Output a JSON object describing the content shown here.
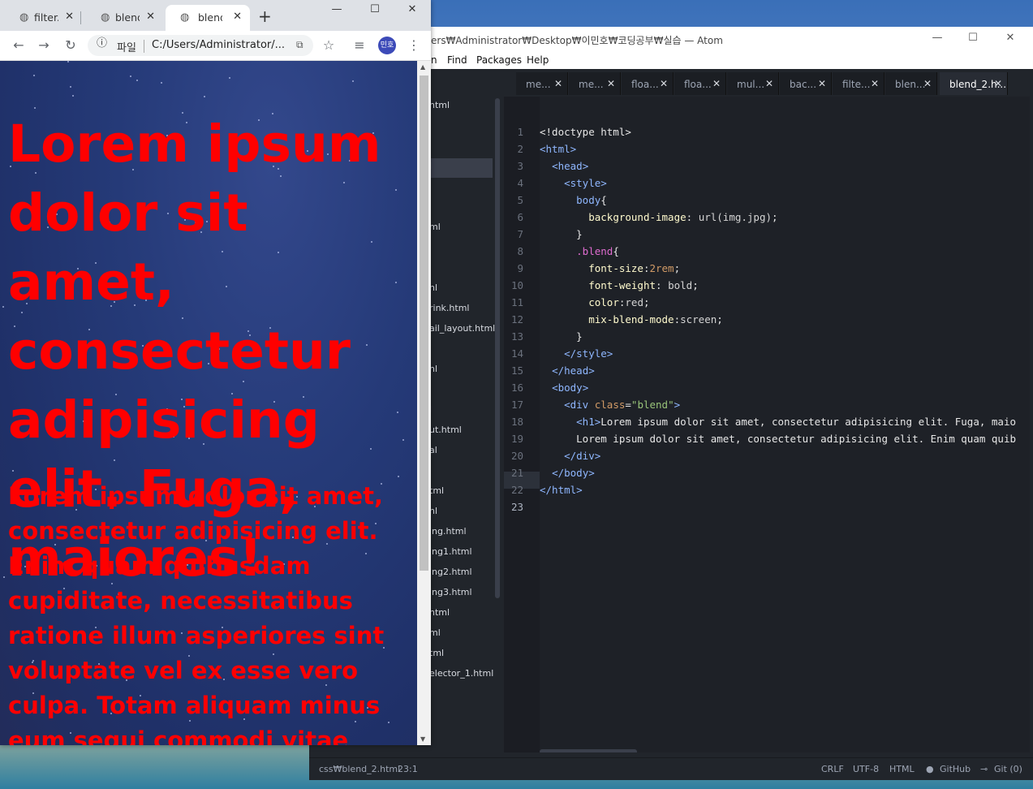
{
  "atom": {
    "title": "ers₩Administrator₩Desktop₩이민호₩코딩공부₩실습 — Atom",
    "window_controls": {
      "minimize": "—",
      "maximize": "☐",
      "close": "✕"
    },
    "menu": [
      "n",
      "Find",
      "Packages",
      "Help"
    ],
    "tabs": [
      {
        "label": "me..."
      },
      {
        "label": "me..."
      },
      {
        "label": "floa..."
      },
      {
        "label": "floa..."
      },
      {
        "label": "mul..."
      },
      {
        "label": "bac..."
      },
      {
        "label": "filte..."
      },
      {
        "label": "blen..."
      },
      {
        "label": "blend_2.h..."
      }
    ],
    "tab_close": "✕",
    "tree_items": [
      "html",
      "l",
      "ml",
      "nl",
      "rink.html",
      "ail_layout.html",
      "nl",
      "l",
      "ut.html",
      "al",
      "tml",
      "nl",
      "ing.html",
      "ing1.html",
      "ing2.html",
      "ing3.html",
      "html",
      "ml",
      "tml",
      "elector_1.html",
      "l"
    ],
    "line_numbers": [
      "1",
      "2",
      "3",
      "4",
      "5",
      "6",
      "7",
      "8",
      "9",
      "10",
      "11",
      "12",
      "13",
      "14",
      "15",
      "16",
      "17",
      "18",
      "19",
      "20",
      "21",
      "22",
      "23"
    ],
    "code": [
      [
        [
          "c-punc",
          "<!doctype html>"
        ]
      ],
      [
        [
          "c-tag",
          "<html>"
        ]
      ],
      [
        [
          "c-punc",
          "  "
        ],
        [
          "c-tag",
          "<head>"
        ]
      ],
      [
        [
          "c-punc",
          "    "
        ],
        [
          "c-tag",
          "<style>"
        ]
      ],
      [
        [
          "c-punc",
          "      "
        ],
        [
          "c-tag",
          "body"
        ],
        [
          "c-punc",
          "{"
        ]
      ],
      [
        [
          "c-punc",
          "        "
        ],
        [
          "c-prop",
          "background-image"
        ],
        [
          "c-punc",
          ": "
        ],
        [
          "c-val",
          "url(img.jpg)"
        ],
        [
          "c-punc",
          ";"
        ]
      ],
      [
        [
          "c-punc",
          "      }"
        ]
      ],
      [
        [
          "c-punc",
          "      "
        ],
        [
          "c-cls",
          ".blend"
        ],
        [
          "c-punc",
          "{"
        ]
      ],
      [
        [
          "c-punc",
          "        "
        ],
        [
          "c-prop",
          "font-size"
        ],
        [
          "c-punc",
          ":"
        ],
        [
          "c-num",
          "2rem"
        ],
        [
          "c-punc",
          ";"
        ]
      ],
      [
        [
          "c-punc",
          "        "
        ],
        [
          "c-prop",
          "font-weight"
        ],
        [
          "c-punc",
          ": "
        ],
        [
          "c-val",
          "bold"
        ],
        [
          "c-punc",
          ";"
        ]
      ],
      [
        [
          "c-punc",
          "        "
        ],
        [
          "c-prop",
          "color"
        ],
        [
          "c-punc",
          ":"
        ],
        [
          "c-val",
          "red"
        ],
        [
          "c-punc",
          ";"
        ]
      ],
      [
        [
          "c-punc",
          "        "
        ],
        [
          "c-prop",
          "mix-blend-mode"
        ],
        [
          "c-punc",
          ":"
        ],
        [
          "c-val",
          "screen"
        ],
        [
          "c-punc",
          ";"
        ]
      ],
      [
        [
          "c-punc",
          "      }"
        ]
      ],
      [
        [
          "c-punc",
          "    "
        ],
        [
          "c-tag",
          "</style>"
        ]
      ],
      [
        [
          "c-punc",
          "  "
        ],
        [
          "c-tag",
          "</head>"
        ]
      ],
      [
        [
          "c-punc",
          "  "
        ],
        [
          "c-tag",
          "<body>"
        ]
      ],
      [
        [
          "c-punc",
          "    "
        ],
        [
          "c-tag",
          "<div "
        ],
        [
          "c-attr",
          "class"
        ],
        [
          "c-punc",
          "="
        ],
        [
          "c-str",
          "\"blend\""
        ],
        [
          "c-tag",
          ">"
        ]
      ],
      [
        [
          "c-punc",
          "      "
        ],
        [
          "c-tag",
          "<h1>"
        ],
        [
          "c-text",
          "Lorem ipsum dolor sit amet, consectetur adipisicing elit. Fuga, maio"
        ]
      ],
      [
        [
          "c-punc",
          "      "
        ],
        [
          "c-text",
          "Lorem ipsum dolor sit amet, consectetur adipisicing elit. Enim quam quib"
        ]
      ],
      [
        [
          "c-punc",
          "    "
        ],
        [
          "c-tag",
          "</div>"
        ]
      ],
      [
        [
          "c-punc",
          "  "
        ],
        [
          "c-tag",
          "</body>"
        ]
      ],
      [
        [
          "c-tag",
          "</html>"
        ]
      ],
      [
        [
          "c-punc",
          ""
        ]
      ]
    ],
    "status": {
      "file": "css₩blend_2.html",
      "cursor": "23:1",
      "line_ending": "CRLF",
      "encoding": "UTF-8",
      "grammar": "HTML",
      "github": "GitHub",
      "git": "Git (0)"
    }
  },
  "chrome": {
    "tabs": [
      {
        "label": "filter.h"
      },
      {
        "label": "blend."
      },
      {
        "label": "blend."
      }
    ],
    "new_tab": "+",
    "window_controls": {
      "minimize": "—",
      "maximize": "☐",
      "close": "✕"
    },
    "nav": {
      "back": "←",
      "forward": "→",
      "reload": "↻"
    },
    "omnibox": {
      "scheme_label": "파일",
      "url": "C:/Users/Administrator/..."
    },
    "profile": "민호",
    "page": {
      "heading": "Lorem ipsum dolor sit amet, consectetur adipisicing elit. Fuga, maiores!",
      "paragraph": "Lorem ipsum dolor sit amet, consectetur adipisicing elit. Enim quam quibusdam cupiditate, necessitatibus ratione illum asperiores sint voluptate vel ex esse vero culpa. Totam aliquam minus eum sequi commodi vitae"
    },
    "text_color": "#ff0000"
  }
}
